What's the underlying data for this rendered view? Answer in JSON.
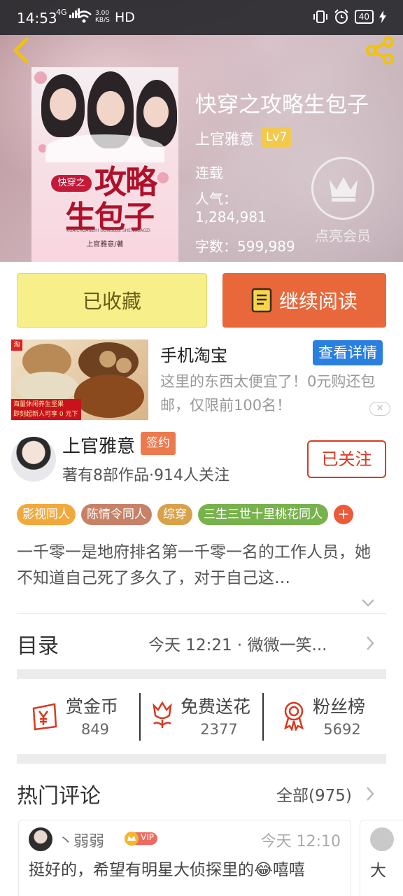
{
  "status_bar": {
    "time": "14:53",
    "network": "4G",
    "speed_value": "3.00",
    "speed_unit": "KB/S",
    "hd": "HD",
    "battery": "40"
  },
  "book": {
    "title": "快穿之攻略生包子",
    "author": "上官雅意",
    "level": "Lv7",
    "status": "连载",
    "popularity_label": "人气：",
    "popularity_value": "1,284,981",
    "word_count": "字数：599,989",
    "cover": {
      "series": "快穿之",
      "title_line1": "攻略",
      "title_line2": "生包子",
      "tiny_text": "KUAICHUANZHI GONGLUE SHENGBAOZI",
      "author": "上官雅意/著"
    }
  },
  "vip": {
    "label": "点亮会员"
  },
  "actions": {
    "favorite": "已收藏",
    "continue_reading": "继续阅读"
  },
  "ad": {
    "title": "手机淘宝",
    "button": "查看详情",
    "description": "这里的东西太便宜了！0元购还包邮，仅限前100名！",
    "close": "✕",
    "corner": "淘",
    "img_line1": "海量休闲养生坚果",
    "img_line2": "即刻起新人可享 0 元下单"
  },
  "author_card": {
    "name": "上官雅意",
    "badge": "签约",
    "stats": "著有8部作品·914人关注",
    "follow": "已关注"
  },
  "tags": [
    {
      "label": "影视同人",
      "color": "#f2a93b"
    },
    {
      "label": "陈情令同人",
      "color": "#c78167"
    },
    {
      "label": "综穿",
      "color": "#d9a24a"
    },
    {
      "label": "三生三世十里桃花同人",
      "color": "#78b24c"
    }
  ],
  "tags_more": "+",
  "synopsis": "一千零一是地府排名第一千零一名的工作人员，她不知道自己死了多久了，对于自己这…",
  "toc": {
    "label": "目录",
    "latest": "今天 12:21 · 微微一笑..."
  },
  "stats": [
    {
      "label": "赏金币",
      "value": "849"
    },
    {
      "label": "免费送花",
      "value": "2377"
    },
    {
      "label": "粉丝榜",
      "value": "5692"
    }
  ],
  "comments": {
    "title": "热门评论",
    "all": "全部(975)",
    "items": [
      {
        "user": "丶弱弱",
        "vip": "VIP",
        "time": "今天 12:10",
        "text": "挺好的，希望有明星大侦探里的😂嘻嘻"
      },
      {
        "text": "大"
      }
    ]
  },
  "colors": {
    "accent_orange": "#e8673b",
    "favorite_yellow": "#f7ef8a",
    "follow_red": "#d9391f",
    "ad_blue": "#2a7fe0"
  }
}
